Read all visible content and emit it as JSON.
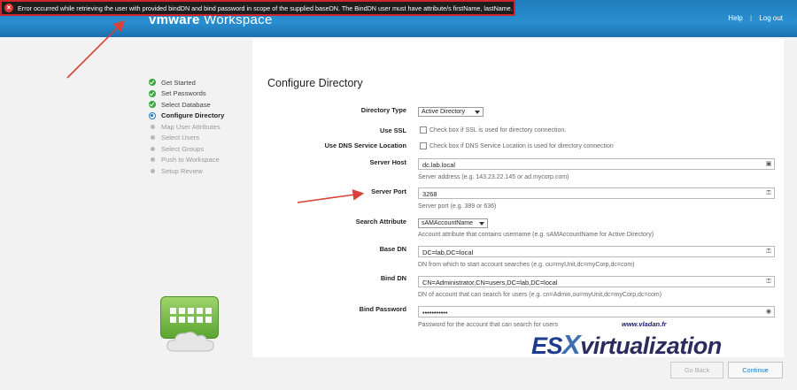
{
  "header": {
    "brand_left": "vmware",
    "brand_right": "Workspace",
    "help_link": "Help",
    "logout_link": "Log out"
  },
  "error": {
    "icon": "error-x-icon",
    "message": "Error occurred while retrieving the user with provided bindDN and bind password in scope of the supplied baseDN. The BindDN user must have attribute/s firstName, lastName."
  },
  "steps": [
    {
      "label": "Get Started",
      "state": "done"
    },
    {
      "label": "Set Passwords",
      "state": "done"
    },
    {
      "label": "Select Database",
      "state": "done"
    },
    {
      "label": "Configure Directory",
      "state": "current"
    },
    {
      "label": "Map User Attributes",
      "state": "pending"
    },
    {
      "label": "Select Users",
      "state": "pending"
    },
    {
      "label": "Select Groups",
      "state": "pending"
    },
    {
      "label": "Push to Workspace",
      "state": "pending"
    },
    {
      "label": "Setup Review",
      "state": "pending"
    }
  ],
  "form": {
    "title": "Configure Directory",
    "directory_type": {
      "label": "Directory Type",
      "value": "Active Directory"
    },
    "use_ssl": {
      "label": "Use SSL",
      "help": "Check box if SSL is used for directory connection."
    },
    "use_dns": {
      "label": "Use DNS Service Location",
      "help": "Check box if DNS Service Location is used for directory connection"
    },
    "server_host": {
      "label": "Server Host",
      "value": "dc.lab.local",
      "help": "Server address (e.g. 143.23.22.145 or ad.mycorp.com)"
    },
    "server_port": {
      "label": "Server Port",
      "value": "3268",
      "help": "Server port (e.g. 389 or 636)"
    },
    "search_attribute": {
      "label": "Search Attribute",
      "value": "sAMAccountName",
      "help": "Account attribute that contains username (e.g. sAMAccountName for Active Directory)"
    },
    "base_dn": {
      "label": "Base DN",
      "value": "DC=lab,DC=local",
      "help": "DN from which to start account searches (e.g. ou=myUnit,dc=myCorp,dc=com)"
    },
    "bind_dn": {
      "label": "Bind DN",
      "value": "CN=Administrator,CN=users,DC=lab,DC=local",
      "help": "DN of account that can search for users (e.g. cn=Admin,ou=myUnit,dc=myCorp,dc=com)"
    },
    "bind_password": {
      "label": "Bind Password",
      "value": "•••••••••••",
      "help": "Password for the account that can search for users"
    }
  },
  "buttons": {
    "back": "Go Back",
    "continue": "Continue"
  },
  "watermark": {
    "small": "www.vladan.fr",
    "es": "ES",
    "x": "X",
    "rest": "virtualization"
  },
  "colors": {
    "header_blue": "#2a8fd0",
    "error_border": "#d0262b",
    "done_green": "#3aa63f",
    "arrow_red": "#d9423a"
  }
}
